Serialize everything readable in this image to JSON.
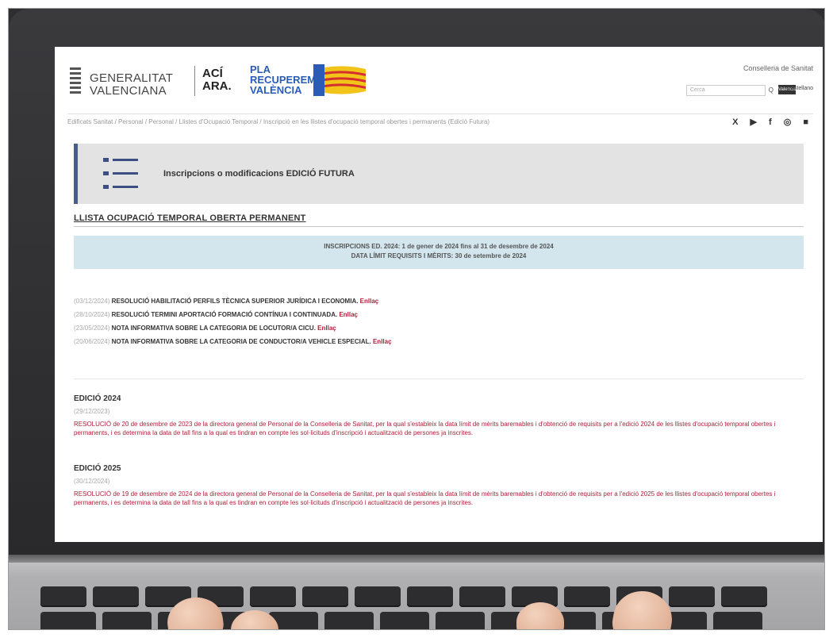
{
  "header": {
    "gv_line1": "GENERALITAT",
    "gv_line2": "VALENCIANA",
    "aci_line1": "ACÍ",
    "aci_line2": "ARA.",
    "pla_line1": "PLA",
    "pla_line2": "RECUPEREM",
    "pla_line3": "VALÈNCIA",
    "department": "Conselleria de Sanitat",
    "search_placeholder": "Cerca",
    "search_go": "Q",
    "lang_active": "Valencià",
    "lang_other": "Castellano"
  },
  "breadcrumb": "Edificats Sanitat  /  Personal  /  Personal  /  Llistes d'Ocupació Temporal  /  Inscripció en les llistes d'ocupació temporal obertes i permanents (Edició Futura)",
  "social": "X ▶ f ◎ ■",
  "banner": {
    "title": "Inscripcions o modificacions EDICIÓ FUTURA"
  },
  "section_title": "LLISTA OCUPACIÓ TEMPORAL OBERTA PERMANENT",
  "infobox": {
    "line1": "INSCRIPCIONS ED. 2024: 1 de gener de 2024 fins al 31 de desembre de 2024",
    "line2": "DATA LÍMIT REQUISITS I MÈRITS: 30 de setembre de 2024"
  },
  "news": [
    {
      "date": "(03/12/2024)",
      "text": "RESOLUCIÓ HABILITACIÓ PERFILS TÈCNICA SUPERIOR JURÍDICA I ECONOMIA.",
      "link": "Enllaç"
    },
    {
      "date": "(28/10/2024)",
      "text": "RESOLUCIÓ TERMINI APORTACIÓ FORMACIÓ CONTÍNUA I CONTINUADA.",
      "link": "Enllaç"
    },
    {
      "date": "(23/05/2024)",
      "text": "NOTA INFORMATIVA SOBRE LA CATEGORIA DE LOCUTOR/A CICU.",
      "link": "Enllaç"
    },
    {
      "date": "(20/06/2024)",
      "text": "NOTA INFORMATIVA SOBRE LA CATEGORIA DE CONDUCTOR/A VEHICLE ESPECIAL.",
      "link": "Enllaç"
    }
  ],
  "editions": [
    {
      "title": "EDICIÓ 2024",
      "date": "(29/12/2023)",
      "text": "RESOLUCIÓ de 20 de desembre de 2023 de la directora general de Personal de la Conselleria de Sanitat, per la qual s'estableix la data límit de mèrits baremables i d'obtenció de requisits per a l'edició 2024 de les llistes d'ocupació temporal obertes i permanents, i es determina la data de tall fins a la qual es tindran en compte les sol·licituds d'inscripció i actualització de persones ja inscrites."
    },
    {
      "title": "EDICIÓ 2025",
      "date": "(30/12/2024)",
      "text": "RESOLUCIÓ de 19 de desembre de 2024 de la directora general de Personal de la Conselleria de Sanitat, per la qual s'estableix la data límit de mèrits baremables i d'obtenció de requisits per a l'edició 2025 de les llistes d'ocupació temporal obertes i permanents, i es determina la data de tall fins a la qual es tindran en compte les sol·licituds d'inscripció i actualització de persones ja inscrites."
    }
  ],
  "colors": {
    "accent_red": "#b0213b",
    "banner_bar": "#4a5d8a",
    "info_bg": "#d3e6ee"
  }
}
